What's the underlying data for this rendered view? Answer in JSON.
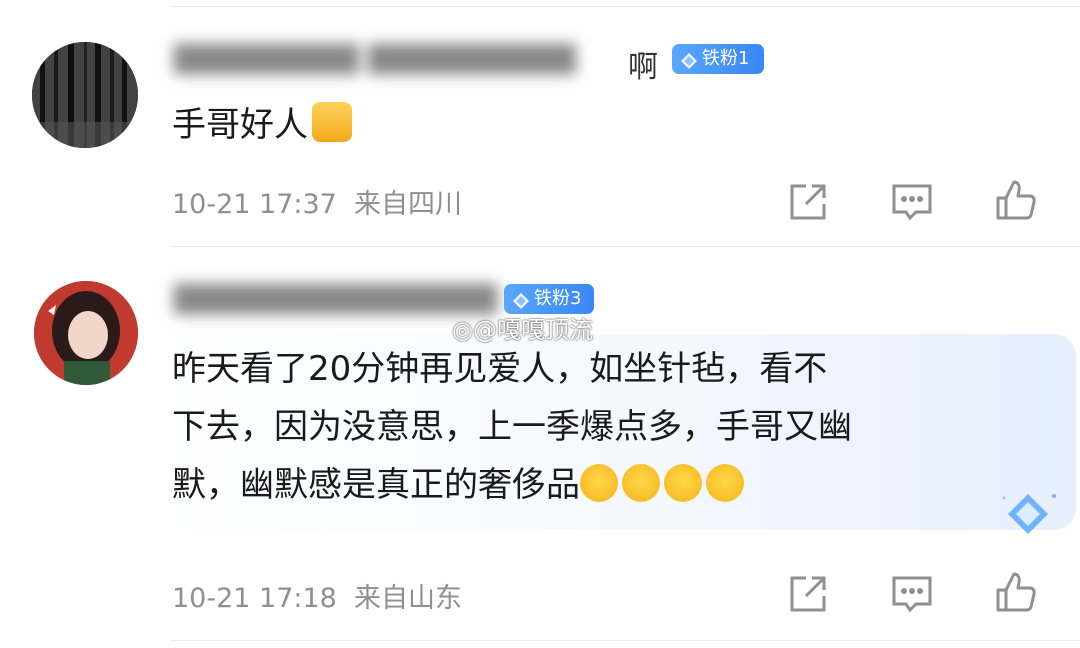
{
  "comments": [
    {
      "username_visible_tail": "啊",
      "badge": "铁粉1",
      "content": "手哥好人",
      "emoji_after": "thumbs-up-icon",
      "timestamp": "10-21 17:37",
      "location": "来自四川"
    },
    {
      "badge": "铁粉3",
      "content_lines": [
        "昨天看了20分钟再见爱人，如坐针毡，看不",
        "下去，因为没意思，上一季爆点多，手哥又幽",
        "默，幽默感是真正的奢侈品"
      ],
      "emoji_after": [
        "laughing-crying-icon",
        "laughing-crying-icon",
        "laughing-crying-icon",
        "laughing-crying-icon"
      ],
      "timestamp": "10-21 17:18",
      "location": "来自山东"
    }
  ],
  "watermark": "@嘎嘎顶流",
  "colors": {
    "badge_blue": "#4a96fb",
    "meta_gray": "#8f8f8f",
    "text": "#1a1a1a"
  }
}
